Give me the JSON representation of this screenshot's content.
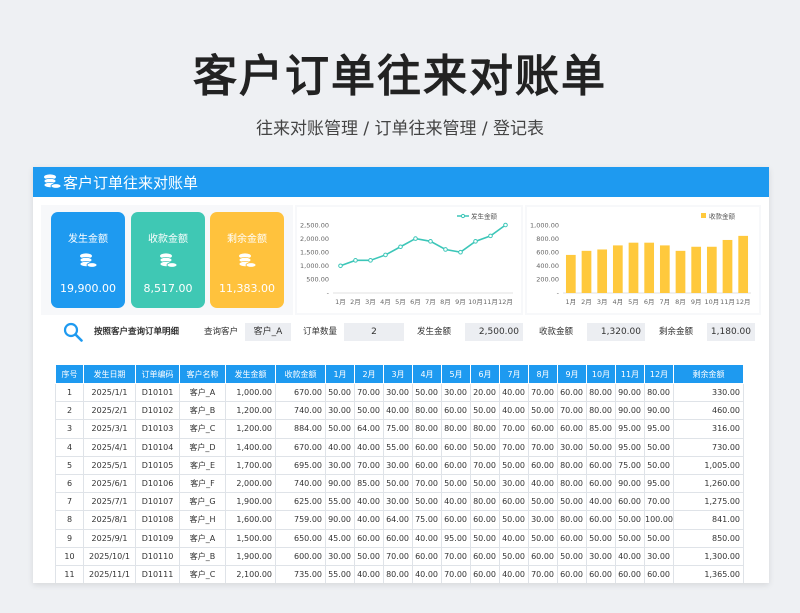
{
  "hero": {
    "title": "客户订单往来对账单",
    "subtitle": "往来对账管理 / 订单往来管理 / 登记表"
  },
  "sheet": {
    "header_title": "客户订单往来对账单"
  },
  "kpis": [
    {
      "label": "发生金额",
      "value": "19,900.00",
      "color": "#1e9af0"
    },
    {
      "label": "收款金额",
      "value": "8,517.00",
      "color": "#3fc8b4"
    },
    {
      "label": "剩余金额",
      "value": "11,383.00",
      "color": "#ffc23d"
    }
  ],
  "line_chart": {
    "type": "line",
    "legend": "发生金额",
    "color": "#3cc6b8",
    "categories": [
      "1月",
      "2月",
      "3月",
      "4月",
      "5月",
      "6月",
      "7月",
      "8月",
      "9月",
      "10月",
      "11月",
      "12月"
    ],
    "values": [
      1000,
      1200,
      1200,
      1400,
      1700,
      2000,
      1900,
      1600,
      1500,
      1900,
      2100,
      2500
    ],
    "yticks": [
      "2,500.00",
      "2,000.00",
      "1,500.00",
      "1,000.00",
      "500.00",
      "-"
    ],
    "ylim": [
      0,
      2500
    ]
  },
  "bar_chart": {
    "type": "bar",
    "legend": "收款金额",
    "color": "#ffc93d",
    "categories": [
      "1月",
      "2月",
      "3月",
      "4月",
      "5月",
      "6月",
      "7月",
      "8月",
      "9月",
      "10月",
      "11月",
      "12月"
    ],
    "values": [
      560,
      620,
      640,
      700,
      740,
      740,
      700,
      620,
      680,
      680,
      780,
      840
    ],
    "yticks": [
      "1,000.00",
      "800.00",
      "600.00",
      "400.00",
      "200.00",
      "-"
    ],
    "ylim": [
      0,
      1000
    ]
  },
  "filter": {
    "search_label": "按照客户查询订单明细",
    "customer_label": "查询客户",
    "customer_value": "客户_A",
    "count_label": "订单数量",
    "count_value": "2",
    "occur_label": "发生金额",
    "occur_value": "2,500.00",
    "receive_label": "收款金额",
    "receive_value": "1,320.00",
    "remain_label": "剩余金额",
    "remain_value": "1,180.00"
  },
  "table": {
    "headers": [
      "序号",
      "发生日期",
      "订单编码",
      "客户名称",
      "发生金额",
      "收款金额",
      "1月",
      "2月",
      "3月",
      "4月",
      "5月",
      "6月",
      "7月",
      "8月",
      "9月",
      "10月",
      "11月",
      "12月",
      "剩余金额"
    ],
    "rows": [
      [
        "1",
        "2025/1/1",
        "D10101",
        "客户_A",
        "1,000.00",
        "670.00",
        "50.00",
        "70.00",
        "30.00",
        "50.00",
        "30.00",
        "20.00",
        "40.00",
        "70.00",
        "60.00",
        "80.00",
        "90.00",
        "80.00",
        "330.00"
      ],
      [
        "2",
        "2025/2/1",
        "D10102",
        "客户_B",
        "1,200.00",
        "740.00",
        "30.00",
        "50.00",
        "40.00",
        "80.00",
        "60.00",
        "50.00",
        "40.00",
        "50.00",
        "70.00",
        "80.00",
        "90.00",
        "90.00",
        "460.00"
      ],
      [
        "3",
        "2025/3/1",
        "D10103",
        "客户_C",
        "1,200.00",
        "884.00",
        "50.00",
        "64.00",
        "75.00",
        "80.00",
        "80.00",
        "80.00",
        "70.00",
        "60.00",
        "60.00",
        "85.00",
        "95.00",
        "95.00",
        "316.00"
      ],
      [
        "4",
        "2025/4/1",
        "D10104",
        "客户_D",
        "1,400.00",
        "670.00",
        "40.00",
        "40.00",
        "55.00",
        "60.00",
        "60.00",
        "50.00",
        "70.00",
        "70.00",
        "30.00",
        "50.00",
        "95.00",
        "50.00",
        "730.00"
      ],
      [
        "5",
        "2025/5/1",
        "D10105",
        "客户_E",
        "1,700.00",
        "695.00",
        "30.00",
        "70.00",
        "30.00",
        "60.00",
        "60.00",
        "70.00",
        "50.00",
        "60.00",
        "80.00",
        "60.00",
        "75.00",
        "50.00",
        "1,005.00"
      ],
      [
        "6",
        "2025/6/1",
        "D10106",
        "客户_F",
        "2,000.00",
        "740.00",
        "90.00",
        "85.00",
        "50.00",
        "70.00",
        "50.00",
        "50.00",
        "30.00",
        "40.00",
        "80.00",
        "60.00",
        "90.00",
        "95.00",
        "1,260.00"
      ],
      [
        "7",
        "2025/7/1",
        "D10107",
        "客户_G",
        "1,900.00",
        "625.00",
        "55.00",
        "40.00",
        "30.00",
        "50.00",
        "40.00",
        "80.00",
        "60.00",
        "50.00",
        "50.00",
        "40.00",
        "60.00",
        "70.00",
        "1,275.00"
      ],
      [
        "8",
        "2025/8/1",
        "D10108",
        "客户_H",
        "1,600.00",
        "759.00",
        "90.00",
        "40.00",
        "64.00",
        "75.00",
        "60.00",
        "60.00",
        "50.00",
        "30.00",
        "80.00",
        "60.00",
        "50.00",
        "100.00",
        "841.00"
      ],
      [
        "9",
        "2025/9/1",
        "D10109",
        "客户_A",
        "1,500.00",
        "650.00",
        "45.00",
        "60.00",
        "60.00",
        "40.00",
        "95.00",
        "50.00",
        "40.00",
        "50.00",
        "60.00",
        "50.00",
        "50.00",
        "50.00",
        "850.00"
      ],
      [
        "10",
        "2025/10/1",
        "D10110",
        "客户_B",
        "1,900.00",
        "600.00",
        "30.00",
        "50.00",
        "70.00",
        "60.00",
        "70.00",
        "60.00",
        "50.00",
        "60.00",
        "50.00",
        "30.00",
        "40.00",
        "30.00",
        "1,300.00"
      ],
      [
        "11",
        "2025/11/1",
        "D10111",
        "客户_C",
        "2,100.00",
        "735.00",
        "55.00",
        "40.00",
        "80.00",
        "40.00",
        "70.00",
        "60.00",
        "40.00",
        "70.00",
        "60.00",
        "60.00",
        "60.00",
        "60.00",
        "1,365.00"
      ]
    ]
  }
}
